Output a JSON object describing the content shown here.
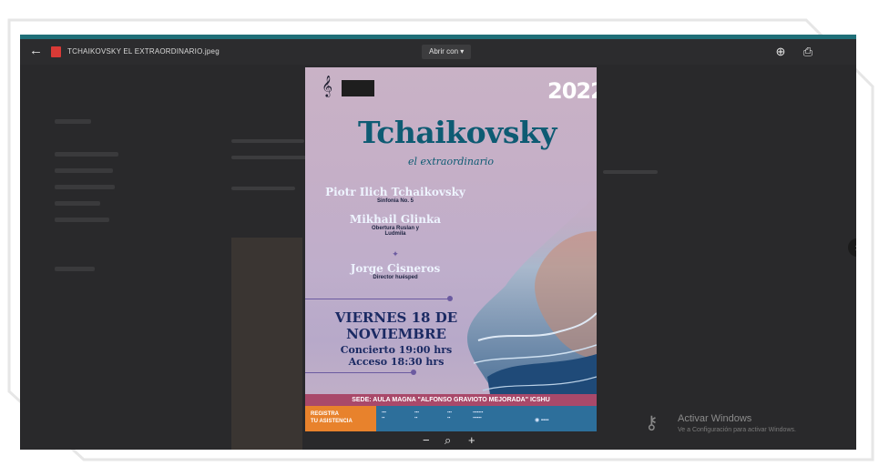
{
  "topbar": {
    "file_name": "TCHAIKOVSKY EL EXTRAORDINARIO.jpeg",
    "open_with_label": "Abrir con",
    "open_with_caret": "▾"
  },
  "icons": {
    "back": "←",
    "add_to_drive": "⊕",
    "print": "⎙",
    "next": "›",
    "zoom_out": "−",
    "zoom_reset": "⌕",
    "zoom_in": "+"
  },
  "poster": {
    "year": "2022",
    "title": "Tchaikovsky",
    "subtitle": "el extraordinario",
    "composer1": "Piotr Ilich Tchaikovsky",
    "work1": "Sinfonía No. 5",
    "composer2": "Mikhail Glinka",
    "work2a": "Obertura Ruslan y",
    "work2b": "Ludmila",
    "conductor": "Jorge Cisneros",
    "conductor_role": "Director huésped",
    "date_line1": "VIERNES 18 DE",
    "date_line2": "NOVIEMBRE",
    "concert_time": "Concierto 19:00 hrs",
    "access_time": "Acceso 18:30 hrs",
    "venue": "SEDE: AULA MAGNA \"ALFONSO GRAVIOTO MEJORADA\" ICSHU",
    "register_line1": "REGISTRA",
    "register_line2": "TU ASISTENCIA"
  },
  "watermark": {
    "line1": "Activar Windows",
    "line2": "Ve a Configuración para activar Windows."
  }
}
